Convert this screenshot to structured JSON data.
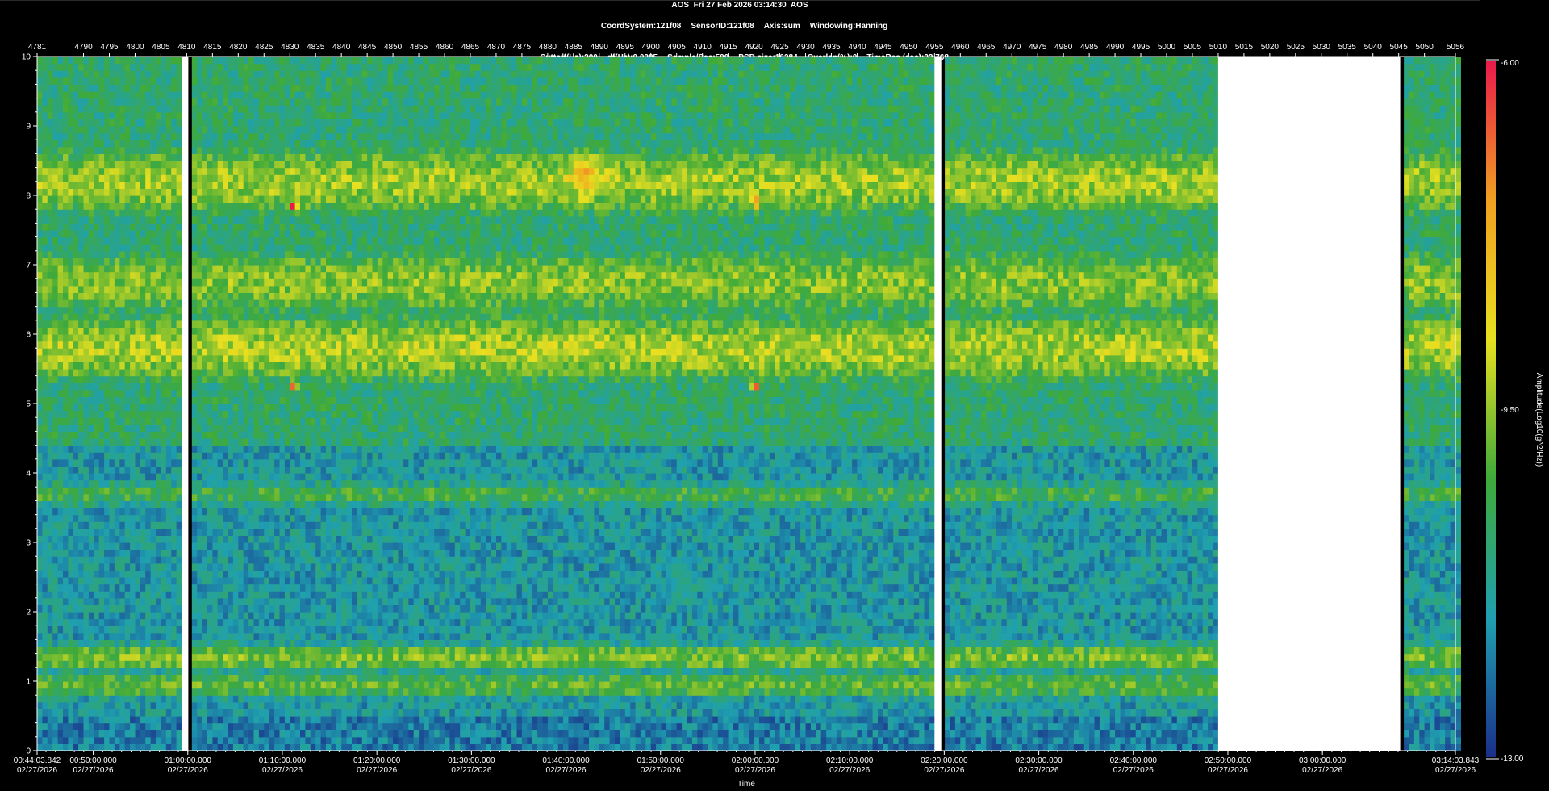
{
  "header": {
    "line1": "AOS  Fri 27 Feb 2026 03:14:30  AOS",
    "line2_items": [
      "CoordSystem:121f08",
      "SensorID:121f08",
      "Axis:sum",
      "Windowing:Hanning"
    ],
    "line3_items": [
      "Cuttoff(Hz):200",
      "df(Hz):0.0305",
      "Sample/Sec:500",
      "PSD size:16384",
      "Overlap(%):0",
      "TimeRes.(sec):32.768"
    ]
  },
  "chart_data": {
    "type": "heatmap",
    "title": "AOS  Fri 27 Feb 2026 03:14:30  AOS",
    "xlabel": "Time",
    "ylabel": "",
    "ylim": [
      0,
      10
    ],
    "yticks": [
      "0",
      "1",
      "2",
      "3",
      "4",
      "5",
      "6",
      "7",
      "8",
      "9",
      "10"
    ],
    "x_index_range": [
      4781,
      5056
    ],
    "top_tick_labels": [
      "4781",
      "4790",
      "4795",
      "4800",
      "4805",
      "4810",
      "4815",
      "4820",
      "4825",
      "4830",
      "4835",
      "4840",
      "4845",
      "4850",
      "4855",
      "4860",
      "4865",
      "4870",
      "4875",
      "4880",
      "4885",
      "4890",
      "4895",
      "4900",
      "4905",
      "4910",
      "4915",
      "4920",
      "4925",
      "4930",
      "4935",
      "4940",
      "4945",
      "4950",
      "4955",
      "4960",
      "4965",
      "4970",
      "4975",
      "4980",
      "4985",
      "4990",
      "4995",
      "5000",
      "5005",
      "5010",
      "5015",
      "5020",
      "5025",
      "5030",
      "5035",
      "5040",
      "5045",
      "5050",
      "5056"
    ],
    "bottom_ticks": [
      {
        "time": "00:44:03.842",
        "date": "02/27/2026"
      },
      {
        "time": "00:50:00.000",
        "date": "02/27/2026"
      },
      {
        "time": "01:00:00.000",
        "date": "02/27/2026"
      },
      {
        "time": "01:10:00.000",
        "date": "02/27/2026"
      },
      {
        "time": "01:20:00.000",
        "date": "02/27/2026"
      },
      {
        "time": "01:30:00.000",
        "date": "02/27/2026"
      },
      {
        "time": "01:40:00.000",
        "date": "02/27/2026"
      },
      {
        "time": "01:50:00.000",
        "date": "02/27/2026"
      },
      {
        "time": "02:00:00.000",
        "date": "02/27/2026"
      },
      {
        "time": "02:10:00.000",
        "date": "02/27/2026"
      },
      {
        "time": "02:20:00.000",
        "date": "02/27/2026"
      },
      {
        "time": "02:30:00.000",
        "date": "02/27/2026"
      },
      {
        "time": "02:40:00.000",
        "date": "02/27/2026"
      },
      {
        "time": "02:50:00.000",
        "date": "02/27/2026"
      },
      {
        "time": "03:00:00.000",
        "date": "02/27/2026"
      },
      {
        "time": "03:14:03.843",
        "date": "02/27/2026"
      }
    ],
    "colorbar": {
      "label": "Amplitude(Log10(g^2/Hz))",
      "max_label": "-6.00",
      "mid_label": "-9.50",
      "min_label": "-13.00",
      "range": [
        -13.0,
        -6.0
      ],
      "colors": [
        "#1a2f8a",
        "#1fa0b0",
        "#3faa3a",
        "#e8e020",
        "#f0a020",
        "#e81a4a"
      ]
    },
    "gaps_index": [
      [
        4809,
        4810
      ],
      [
        4955,
        4956
      ],
      [
        5010,
        5045
      ]
    ],
    "bands": [
      {
        "freq_hz": 6.75,
        "value": -9.6
      },
      {
        "freq_hz": 5.8,
        "value": -9.3
      },
      {
        "freq_hz": 8.2,
        "value": -9.4
      },
      {
        "freq_hz": 1.35,
        "value": -9.7
      },
      {
        "freq_hz": 0.95,
        "value": -10.0
      },
      {
        "freq_hz": 3.7,
        "value": -10.3
      },
      {
        "freq_hz": 2.75,
        "value": -12.2
      }
    ],
    "hotspots": [
      {
        "index": 4830,
        "freq_hz": 7.85,
        "value": -6.3
      },
      {
        "index": 4830,
        "freq_hz": 5.25,
        "value": -6.3
      },
      {
        "index": 4920,
        "freq_hz": 7.9,
        "value": -6.3
      },
      {
        "index": 4920,
        "freq_hz": 5.25,
        "value": -6.3
      },
      {
        "index": 4887,
        "freq_hz": 8.3,
        "value": -7.8
      }
    ]
  }
}
